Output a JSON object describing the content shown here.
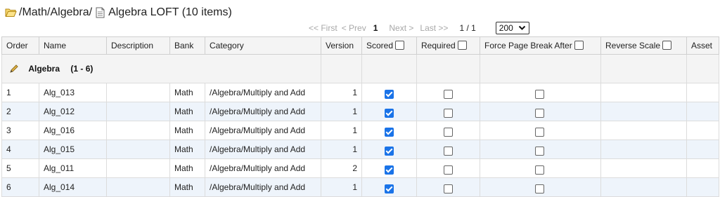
{
  "breadcrumb": {
    "folder_icon": "folder-open-icon",
    "path": "/Math/Algebra/",
    "doc_icon": "document-icon",
    "title": "Algebra LOFT (10 items)"
  },
  "pager": {
    "first": "<< First",
    "prev": "< Prev",
    "current_page": "1",
    "next": "Next >",
    "last": "Last >>",
    "page_count": "1 / 1",
    "page_size": "200"
  },
  "columns": {
    "order": "Order",
    "name": "Name",
    "description": "Description",
    "bank": "Bank",
    "category": "Category",
    "version": "Version",
    "scored": "Scored",
    "required": "Required",
    "force_page_break": "Force Page Break After",
    "reverse_scale": "Reverse Scale",
    "asset": "Asset"
  },
  "group": {
    "icon": "pencil-edit-icon",
    "label": "Algebra",
    "range": "(1 - 6)"
  },
  "rows": [
    {
      "order": "1",
      "name": "Alg_013",
      "description": "",
      "bank": "Math",
      "category": "/Algebra/Multiply and Add",
      "version": "1",
      "scored": true,
      "required": false,
      "force_page_break": false
    },
    {
      "order": "2",
      "name": "Alg_012",
      "description": "",
      "bank": "Math",
      "category": "/Algebra/Multiply and Add",
      "version": "1",
      "scored": true,
      "required": false,
      "force_page_break": false
    },
    {
      "order": "3",
      "name": "Alg_016",
      "description": "",
      "bank": "Math",
      "category": "/Algebra/Multiply and Add",
      "version": "1",
      "scored": true,
      "required": false,
      "force_page_break": false
    },
    {
      "order": "4",
      "name": "Alg_015",
      "description": "",
      "bank": "Math",
      "category": "/Algebra/Multiply and Add",
      "version": "1",
      "scored": true,
      "required": false,
      "force_page_break": false
    },
    {
      "order": "5",
      "name": "Alg_011",
      "description": "",
      "bank": "Math",
      "category": "/Algebra/Multiply and Add",
      "version": "2",
      "scored": true,
      "required": false,
      "force_page_break": false
    },
    {
      "order": "6",
      "name": "Alg_014",
      "description": "",
      "bank": "Math",
      "category": "/Algebra/Multiply and Add",
      "version": "1",
      "scored": true,
      "required": false,
      "force_page_break": false
    }
  ],
  "colors": {
    "checkbox_checked": "#1a73e8",
    "row_alt": "#eef4fb",
    "header_bg": "#f4f4f4",
    "pager_disabled": "#a8a8a8"
  }
}
